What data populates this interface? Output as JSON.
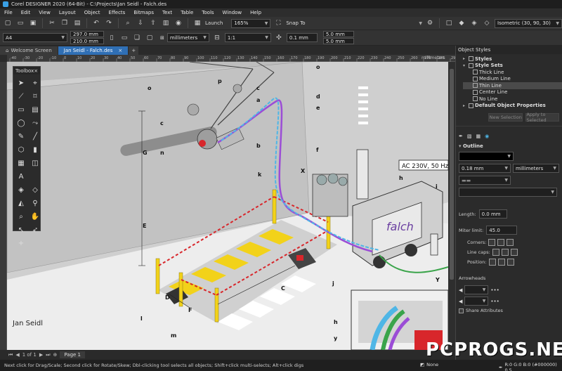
{
  "window": {
    "title": "Corel DESIGNER 2020 (64-Bit) - C:\\Projects\\Jan Seidl - Falch.des"
  },
  "menu": [
    "File",
    "Edit",
    "View",
    "Layout",
    "Object",
    "Effects",
    "Bitmaps",
    "Text",
    "Table",
    "Tools",
    "Window",
    "Help"
  ],
  "toolbar1": {
    "launch_label": "Launch",
    "zoom_value": "165%",
    "snap_label": "Snap To",
    "view_preset": "Isometric (30, 90, 30)"
  },
  "toolbar2": {
    "page_size": "A4",
    "width": "297.0 mm",
    "height": "210.0 mm",
    "units": "millimeters",
    "scale": "1:1",
    "nudge": "0.1 mm",
    "dup_x": "5.0 mm",
    "dup_y": "5.0 mm"
  },
  "doc_tabs": [
    {
      "label": "Welcome Screen",
      "active": false
    },
    {
      "label": "Jan Seidl - Falch.des",
      "active": true
    }
  ],
  "ruler": {
    "unit": "millimeters",
    "h_ticks": [
      "-40",
      "-30",
      "-20",
      "-10",
      "0",
      "10",
      "20",
      "30",
      "40",
      "50",
      "60",
      "70",
      "80",
      "90",
      "100",
      "110",
      "120",
      "130",
      "140",
      "150",
      "160",
      "170",
      "180",
      "190",
      "200",
      "210",
      "220",
      "230",
      "240",
      "250",
      "260",
      "270",
      "280",
      "290"
    ]
  },
  "toolbox": {
    "title": "Toolbox"
  },
  "illustration": {
    "callout_letters": [
      "o",
      "p",
      "c",
      "a",
      "d",
      "e",
      "c",
      "b",
      "n",
      "f",
      "k",
      "X",
      "h",
      "i",
      "G",
      "E",
      "l",
      "m",
      "C",
      "j",
      "D",
      "F",
      "Y",
      "h",
      "y",
      "o"
    ],
    "voltage_label": "AC 230V, 50 Hz",
    "brand_logo": "falch",
    "author": "Jan Seidl"
  },
  "page_bar": {
    "page_label": "Page 1",
    "page_counter": "1 of 1"
  },
  "status": {
    "hint": "Next click for Drag/Scale; Second click for Rotate/Skew; Dbl-clicking tool selects all objects; Shift+click multi-selects; Alt+click digs",
    "fill": "None",
    "stroke": "R:0 G:0 B:0 (#000000) 0.5"
  },
  "right_panel": {
    "title": "Object Styles",
    "tree": [
      {
        "label": "Styles",
        "level": 1,
        "bold": true
      },
      {
        "label": "Style Sets",
        "level": 1,
        "bold": true
      },
      {
        "label": "Thick Line",
        "level": 2
      },
      {
        "label": "Medium Line",
        "level": 2
      },
      {
        "label": "Thin Line",
        "level": 2,
        "selected": true
      },
      {
        "label": "Center Line",
        "level": 2
      },
      {
        "label": "No Line",
        "level": 2
      },
      {
        "label": "Default Object Properties",
        "level": 1,
        "bold": true
      }
    ],
    "buttons": [
      "New Selection",
      "Apply to Selected"
    ],
    "outline": {
      "heading": "Outline",
      "width": "0.18 mm",
      "units": "millimeters",
      "length_label": "Length:",
      "length_value": "0.0 mm",
      "miter_label": "Miter limit:",
      "miter_value": "45.0",
      "corners_label": "Corners:",
      "linecaps_label": "Line caps:",
      "position_label": "Position:"
    },
    "arrowheads": {
      "heading": "Arrowheads",
      "share_label": "Share Attributes"
    }
  },
  "watermark": "PCPROGS.NET",
  "colors": {
    "accent": "#2f6fb5",
    "cyan_line": "#4fb6e6",
    "purple_line": "#9b4dd6",
    "green_line": "#3aa44a",
    "yellow": "#f2d21a",
    "red": "#d8262b"
  }
}
